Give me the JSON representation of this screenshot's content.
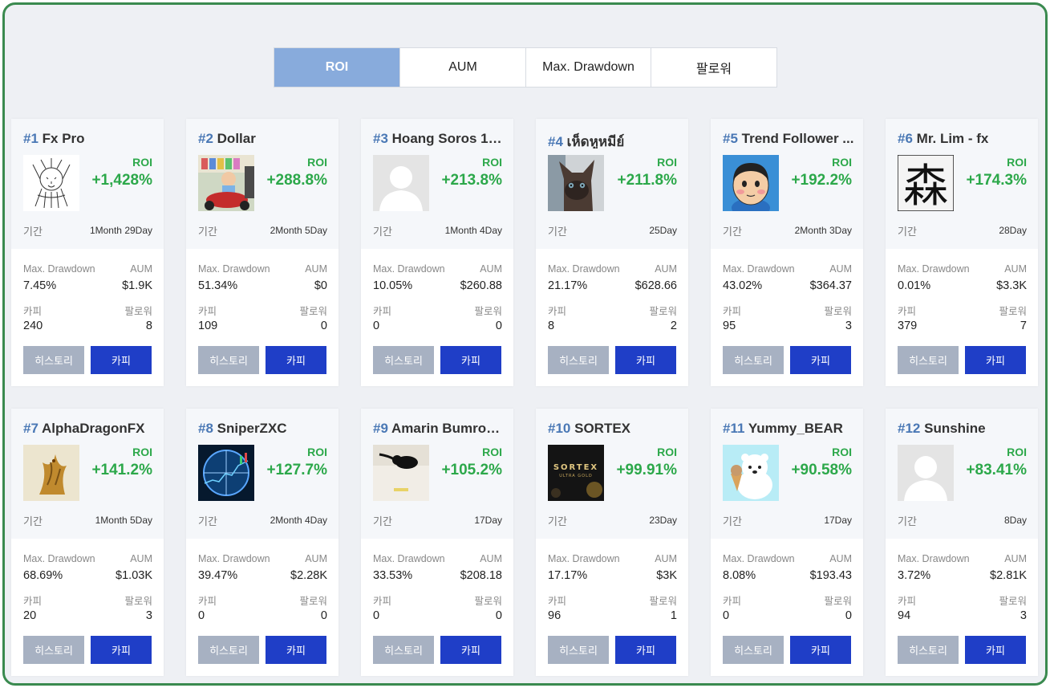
{
  "tabs": [
    {
      "label": "ROI",
      "active": true
    },
    {
      "label": "AUM",
      "active": false
    },
    {
      "label": "Max. Drawdown",
      "active": false
    },
    {
      "label": "팔로워",
      "active": false
    }
  ],
  "labels": {
    "roi": "ROI",
    "period": "기간",
    "max_drawdown": "Max. Drawdown",
    "aum": "AUM",
    "copy": "카피",
    "followers": "팔로워",
    "history_button": "히스토리",
    "copy_button": "카피"
  },
  "colors": {
    "frame_border": "#3a8a4f",
    "tab_active": "#88abdc",
    "rank": "#4a78b5",
    "roi_green": "#2ca84a",
    "history_button": "#a7b1c2",
    "copy_button": "#1f3ec7"
  },
  "traders": [
    {
      "rank": "#1",
      "name": "Fx Pro",
      "roi": "+1,428%",
      "period": "1Month 29Day",
      "max_drawdown": "7.45%",
      "aum": "$1.9K",
      "copies": "240",
      "followers": "8",
      "avatar": "lion-sketch"
    },
    {
      "rank": "#2",
      "name": "Dollar",
      "roi": "+288.8%",
      "period": "2Month 5Day",
      "max_drawdown": "51.34%",
      "aum": "$0",
      "copies": "109",
      "followers": "0",
      "avatar": "child-on-bike"
    },
    {
      "rank": "#3",
      "name": "Hoang Soros 18...",
      "roi": "+213.8%",
      "period": "1Month 4Day",
      "max_drawdown": "10.05%",
      "aum": "$260.88",
      "copies": "0",
      "followers": "0",
      "avatar": "default-person"
    },
    {
      "rank": "#4",
      "name": "เห็ดหูหมีย์",
      "roi": "+211.8%",
      "period": "25Day",
      "max_drawdown": "21.17%",
      "aum": "$628.66",
      "copies": "8",
      "followers": "2",
      "avatar": "cat"
    },
    {
      "rank": "#5",
      "name": "Trend Follower ...",
      "roi": "+192.2%",
      "period": "2Month 3Day",
      "max_drawdown": "43.02%",
      "aum": "$364.37",
      "copies": "95",
      "followers": "3",
      "avatar": "cartoon-boy"
    },
    {
      "rank": "#6",
      "name": "Mr. Lim - fx",
      "roi": "+174.3%",
      "period": "28Day",
      "max_drawdown": "0.01%",
      "aum": "$3.3K",
      "copies": "379",
      "followers": "7",
      "avatar": "kanji-forest",
      "avatar_text": "森"
    },
    {
      "rank": "#7",
      "name": "AlphaDragonFX",
      "roi": "+141.2%",
      "period": "1Month 5Day",
      "max_drawdown": "68.69%",
      "aum": "$1.03K",
      "copies": "20",
      "followers": "3",
      "avatar": "golden-dragon"
    },
    {
      "rank": "#8",
      "name": "SniperZXC",
      "roi": "+127.7%",
      "period": "2Month 4Day",
      "max_drawdown": "39.47%",
      "aum": "$2.28K",
      "copies": "0",
      "followers": "0",
      "avatar": "scope-chart"
    },
    {
      "rank": "#9",
      "name": "Amarin Bumroo...",
      "roi": "+105.2%",
      "period": "17Day",
      "max_drawdown": "33.53%",
      "aum": "$208.18",
      "copies": "0",
      "followers": "0",
      "avatar": "black-cat-sleeping"
    },
    {
      "rank": "#10",
      "name": "SORTEX",
      "roi": "+99.91%",
      "period": "23Day",
      "max_drawdown": "17.17%",
      "aum": "$3K",
      "copies": "96",
      "followers": "1",
      "avatar": "sortex-logo",
      "avatar_text": "SORTEX",
      "avatar_subtext": "ULTRA GOLD"
    },
    {
      "rank": "#11",
      "name": "Yummy_BEAR",
      "roi": "+90.58%",
      "period": "17Day",
      "max_drawdown": "8.08%",
      "aum": "$193.43",
      "copies": "0",
      "followers": "0",
      "avatar": "polar-bear-icecream"
    },
    {
      "rank": "#12",
      "name": "Sunshine",
      "roi": "+83.41%",
      "period": "8Day",
      "max_drawdown": "3.72%",
      "aum": "$2.81K",
      "copies": "94",
      "followers": "3",
      "avatar": "default-person"
    }
  ]
}
